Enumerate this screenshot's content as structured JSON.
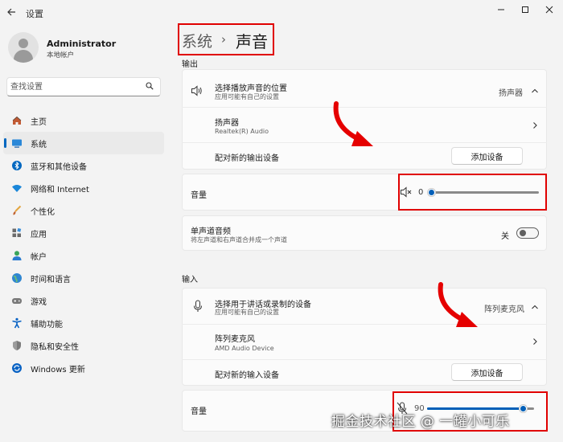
{
  "window": {
    "title": "设置",
    "back_icon": "back-arrow-icon",
    "controls": [
      "minimize-icon",
      "maximize-icon",
      "close-icon"
    ]
  },
  "user": {
    "name": "Administrator",
    "account_type": "本地帐户"
  },
  "search": {
    "placeholder": "查找设置"
  },
  "sidebar": {
    "items": [
      {
        "label": "主页",
        "icon": "home-icon"
      },
      {
        "label": "系统",
        "icon": "system-icon",
        "active": true
      },
      {
        "label": "蓝牙和其他设备",
        "icon": "bluetooth-icon"
      },
      {
        "label": "网络和 Internet",
        "icon": "wifi-icon"
      },
      {
        "label": "个性化",
        "icon": "brush-icon"
      },
      {
        "label": "应用",
        "icon": "apps-icon"
      },
      {
        "label": "帐户",
        "icon": "account-icon"
      },
      {
        "label": "时间和语言",
        "icon": "globe-icon"
      },
      {
        "label": "游戏",
        "icon": "gamepad-icon"
      },
      {
        "label": "辅助功能",
        "icon": "accessibility-icon"
      },
      {
        "label": "隐私和安全性",
        "icon": "shield-icon"
      },
      {
        "label": "Windows 更新",
        "icon": "update-icon"
      }
    ]
  },
  "breadcrumb": {
    "parent": "系统",
    "separator": "›",
    "current": "声音"
  },
  "output": {
    "section_label": "输出",
    "choose_device": {
      "title": "选择播放声音的位置",
      "subtitle": "应用可能有自己的设置",
      "value": "扬声器"
    },
    "device": {
      "title": "扬声器",
      "subtitle": "Realtek(R) Audio"
    },
    "pair": {
      "title": "配对新的输出设备",
      "button": "添加设备"
    },
    "volume": {
      "label": "音量",
      "value": "0",
      "level": 0,
      "icon": "speaker-muted-icon"
    },
    "mono": {
      "title": "单声道音频",
      "subtitle": "将左声道和右声道合并成一个声道",
      "state": "关"
    }
  },
  "input": {
    "section_label": "输入",
    "choose_device": {
      "title": "选择用于讲话或录制的设备",
      "subtitle": "应用可能有自己的设置",
      "value": "阵列麦克风"
    },
    "device": {
      "title": "阵列麦克风",
      "subtitle": "AMD Audio Device"
    },
    "pair": {
      "title": "配对新的输入设备",
      "button": "添加设备"
    },
    "volume": {
      "label": "音量",
      "value": "90",
      "level": 0.9,
      "icon": "microphone-muted-icon"
    }
  },
  "watermark": "掘金技术社区 @ 一罐小可乐",
  "colors": {
    "accent": "#005fb8",
    "annotation": "#e00000"
  }
}
